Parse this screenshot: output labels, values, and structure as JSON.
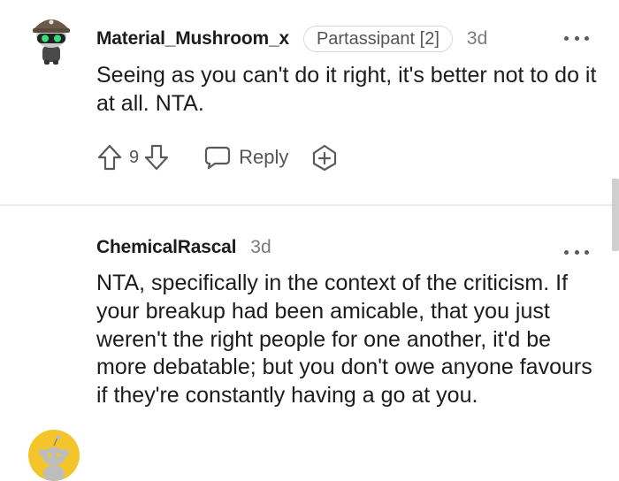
{
  "comments": [
    {
      "username": "Material_Mushroom_x",
      "flair": "Partassipant [2]",
      "time": "3d",
      "body": "Seeing as you can't do it right, it's better not to do it at all. NTA.",
      "score": "9",
      "reply_label": "Reply",
      "avatar_icon": "snoo-avatar-hat-icon"
    },
    {
      "username": "ChemicalRascal",
      "time": "3d",
      "body": "NTA, specifically in the context of the criticism. If your breakup had been amicable, that you just weren't the right people for one another, it'd be more debatable; but you don't owe anyone favours if they're constantly having a go at you.",
      "avatar_icon": "snoo-default-avatar-icon"
    }
  ],
  "colors": {
    "text": "#1c1c1c",
    "muted": "#7a7a7a",
    "avatar_yellow": "#f3c52a",
    "divider": "#ececec"
  }
}
